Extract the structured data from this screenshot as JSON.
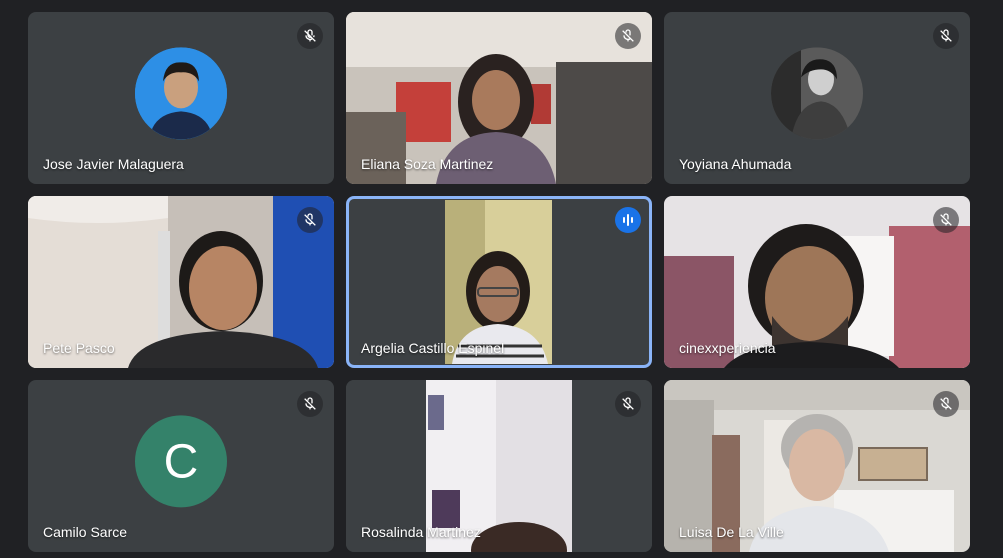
{
  "participants": [
    {
      "name": "Jose Javier Malaguera",
      "muted": true
    },
    {
      "name": "Eliana Soza Martinez",
      "muted": true
    },
    {
      "name": "Yoyiana Ahumada",
      "muted": true
    },
    {
      "name": "Pete Pasco",
      "muted": true
    },
    {
      "name": "Argelia Castillo Espinel",
      "muted": false,
      "speaking": true
    },
    {
      "name": "cinexxperiencia",
      "muted": true
    },
    {
      "name": "Camilo Sarce",
      "muted": true,
      "avatar_letter": "C"
    },
    {
      "name": "Rosalinda Martinez",
      "muted": true
    },
    {
      "name": "Luisa De La Ville",
      "muted": true
    }
  ],
  "colors": {
    "background": "#202124",
    "tile": "#3c4043",
    "speaking_border": "#8ab4f8",
    "speaking_badge": "#1a73e8",
    "letter_avatar": "#34826a"
  },
  "icons": {
    "muted": "mic-off-icon",
    "speaking": "audio-level-icon"
  }
}
